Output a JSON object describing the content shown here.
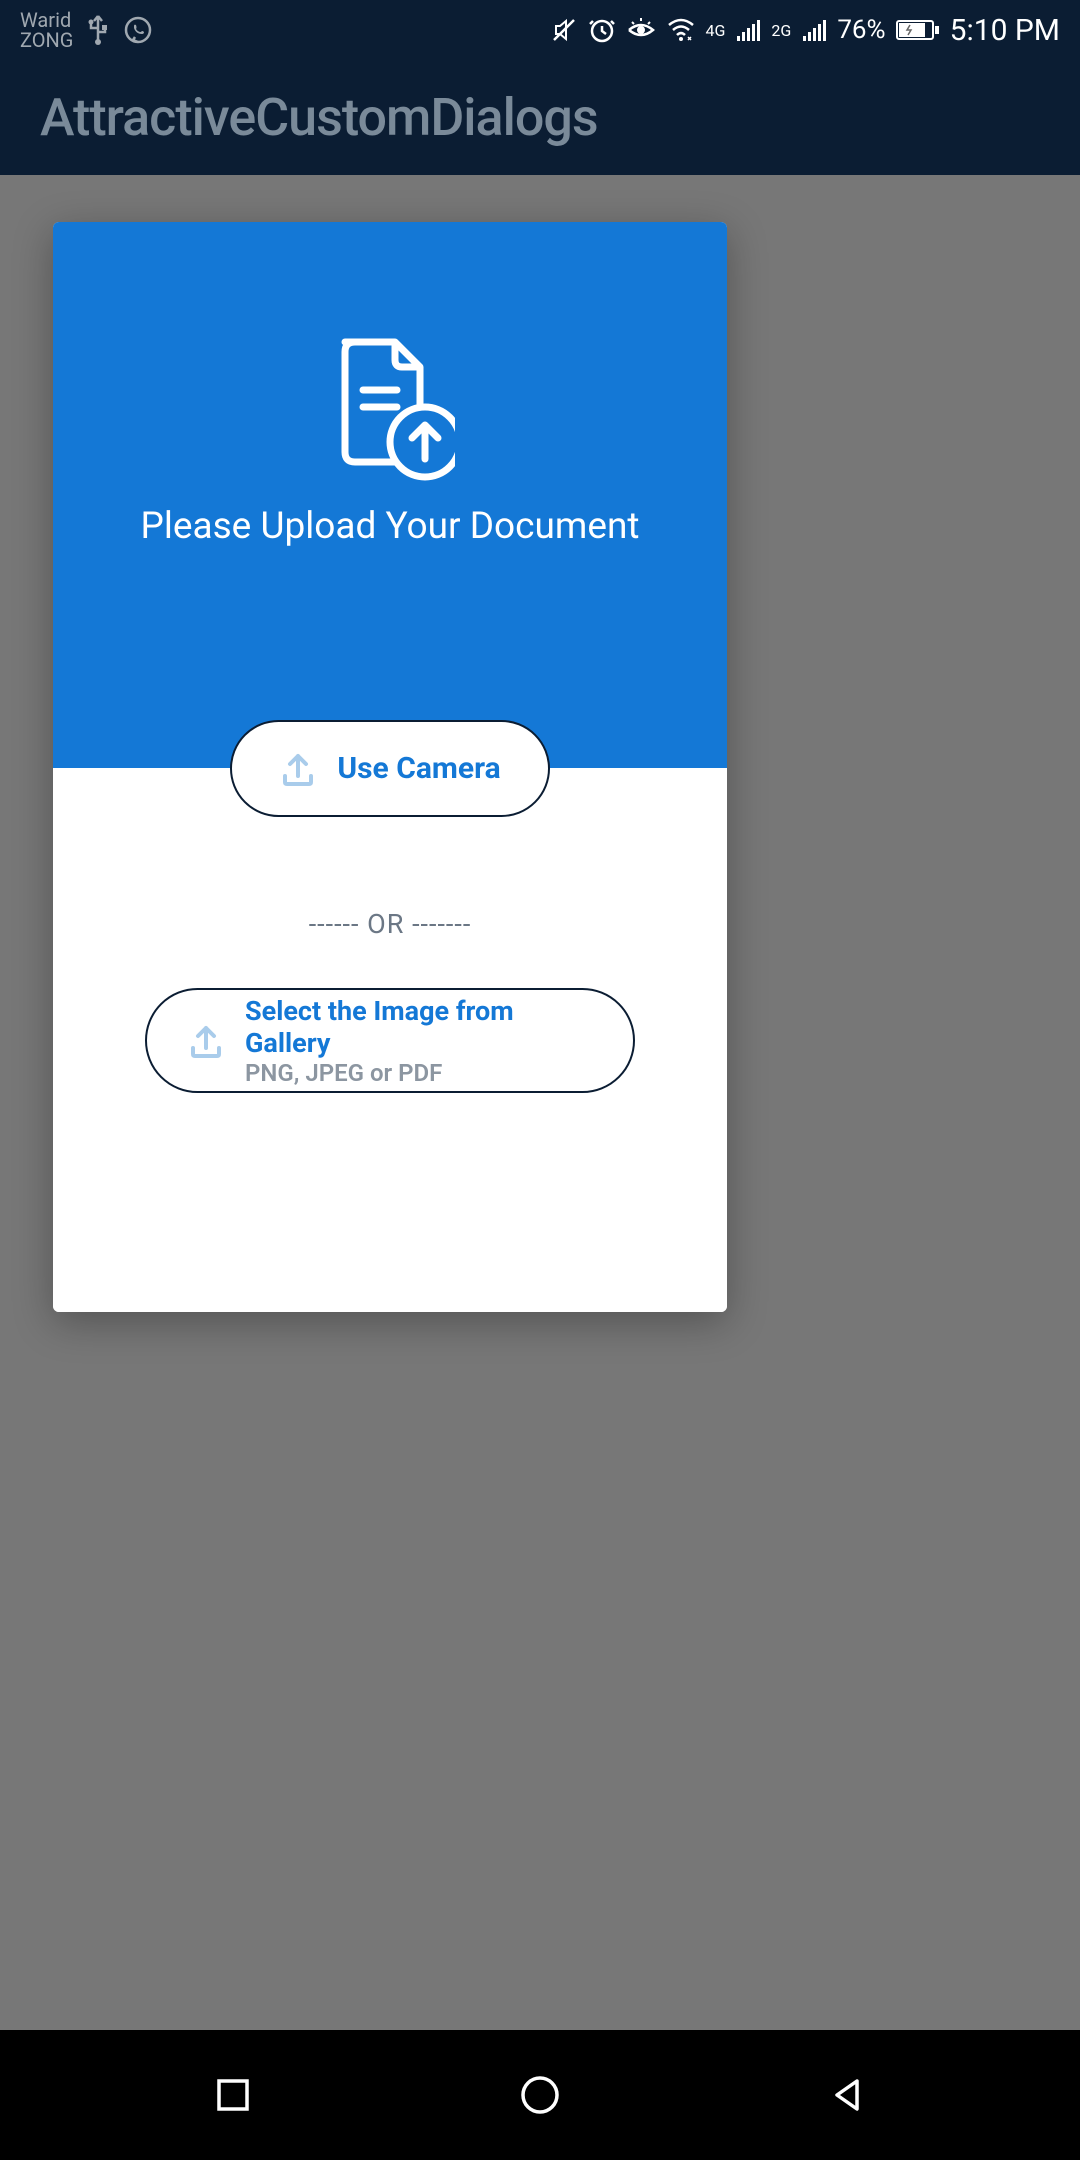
{
  "status_bar": {
    "carrier_line1": "Warid",
    "carrier_line2": "ZONG",
    "battery_percent": "76%",
    "time": "5:10 PM",
    "network1": "4G",
    "network2": "2G"
  },
  "app_bar": {
    "title": "AttractiveCustomDialogs"
  },
  "dialog": {
    "title": "Please Upload Your Document",
    "camera_button_label": "Use Camera",
    "divider_text": "------  OR  -------",
    "gallery_button_label": "Select the Image from Gallery",
    "gallery_button_sublabel": "PNG, JPEG or PDF"
  }
}
